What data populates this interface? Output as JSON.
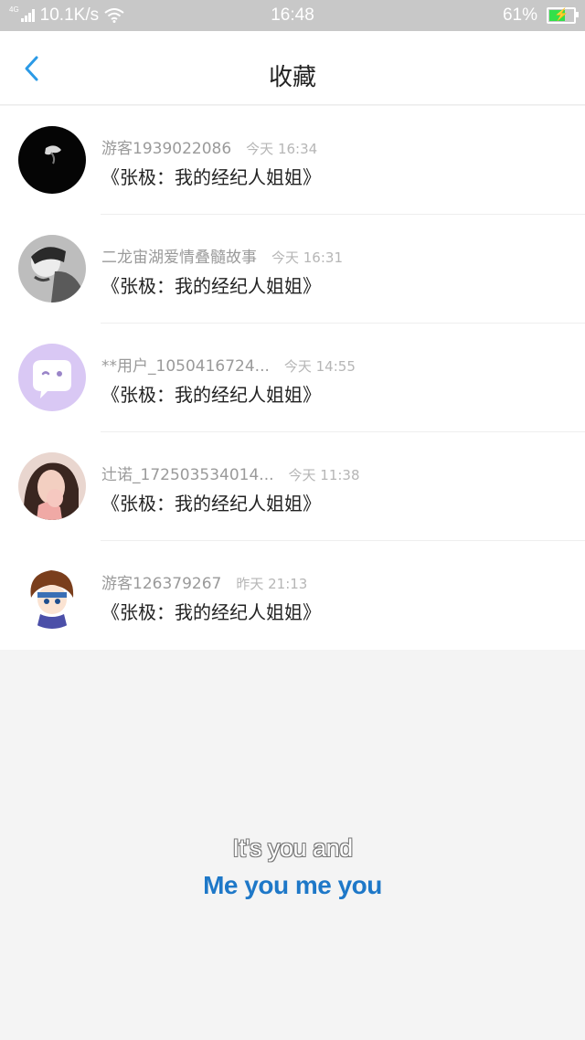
{
  "status_bar": {
    "network": "4G",
    "speed": "10.1K/s",
    "time": "16:48",
    "battery": "61%"
  },
  "header": {
    "title": "收藏",
    "back_icon": "chevron-left-icon"
  },
  "colors": {
    "accent": "#2b9ae6",
    "lyric_blue": "#1e78c8",
    "battery_green": "#33e04a"
  },
  "favorites": [
    {
      "user": "游客1939022086",
      "time": "今天 16:34",
      "title": "《张极：我的经纪人姐姐》",
      "avatar": "dark-portrait"
    },
    {
      "user": "二龙宙湖爱情叠髓故事",
      "time": "今天 16:31",
      "title": "《张极：我的经纪人姐姐》",
      "avatar": "bw-photo"
    },
    {
      "user": "**用户_1050416724...",
      "time": "今天 14:55",
      "title": "《张极：我的经纪人姐姐》",
      "avatar": "chat-bubble-default"
    },
    {
      "user": "辻诺_172503534014...",
      "time": "今天 11:38",
      "title": "《张极：我的经纪人姐姐》",
      "avatar": "girl-photo"
    },
    {
      "user": "游客126379267",
      "time": "昨天 21:13",
      "title": "《张极：我的经纪人姐姐》",
      "avatar": "anime-boy"
    }
  ],
  "lyrics": {
    "line1": "It's you and",
    "line2": "Me you me you"
  }
}
